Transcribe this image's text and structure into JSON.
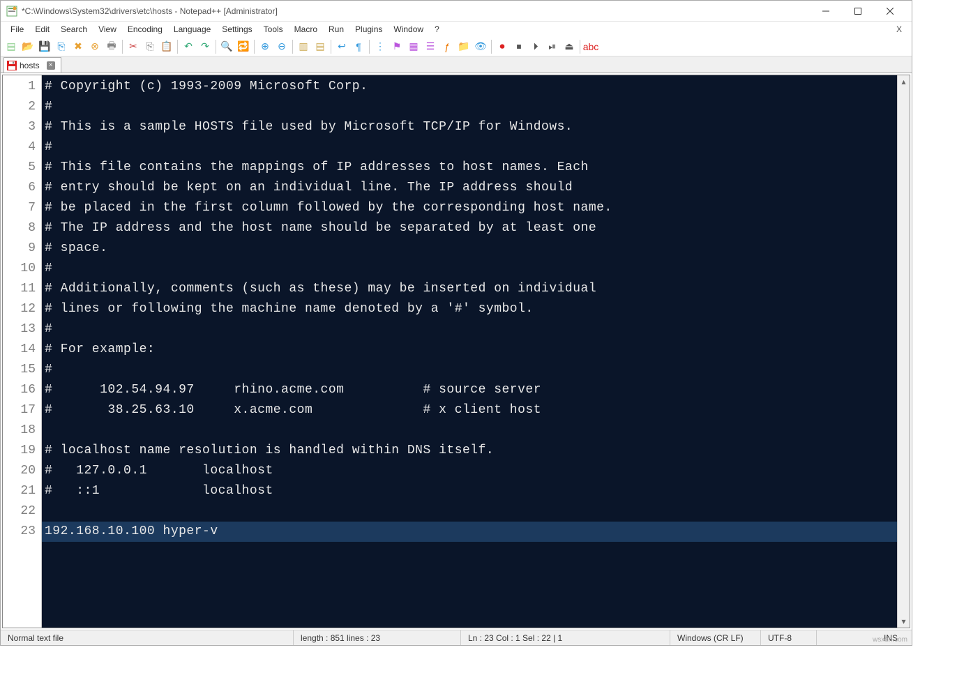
{
  "window": {
    "title": "*C:\\Windows\\System32\\drivers\\etc\\hosts - Notepad++ [Administrator]"
  },
  "menu": {
    "items": [
      "File",
      "Edit",
      "Search",
      "View",
      "Encoding",
      "Language",
      "Settings",
      "Tools",
      "Macro",
      "Run",
      "Plugins",
      "Window",
      "?"
    ],
    "close_x": "X"
  },
  "tab": {
    "name": "hosts",
    "close": "×"
  },
  "code_lines": [
    "# Copyright (c) 1993-2009 Microsoft Corp.",
    "#",
    "# This is a sample HOSTS file used by Microsoft TCP/IP for Windows.",
    "#",
    "# This file contains the mappings of IP addresses to host names. Each",
    "# entry should be kept on an individual line. The IP address should",
    "# be placed in the first column followed by the corresponding host name.",
    "# The IP address and the host name should be separated by at least one",
    "# space.",
    "#",
    "# Additionally, comments (such as these) may be inserted on individual",
    "# lines or following the machine name denoted by a '#' symbol.",
    "#",
    "# For example:",
    "#",
    "#      102.54.94.97     rhino.acme.com          # source server",
    "#       38.25.63.10     x.acme.com              # x client host",
    "",
    "# localhost name resolution is handled within DNS itself.",
    "#   127.0.0.1       localhost",
    "#   ::1             localhost",
    "",
    "192.168.10.100 hyper-v"
  ],
  "highlight_line": 23,
  "status": {
    "filetype": "Normal text file",
    "length": "length : 851    lines : 23",
    "cursor": "Ln : 23    Col : 1    Sel : 22 | 1",
    "eol": "Windows (CR LF)",
    "encoding": "UTF-8",
    "mode": "INS"
  },
  "watermark": "wsxdn.com"
}
